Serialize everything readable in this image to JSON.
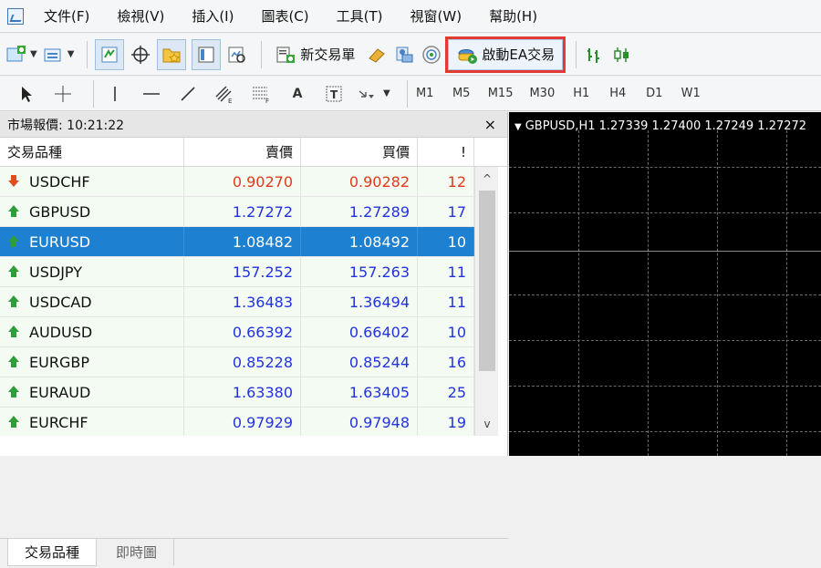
{
  "menu": [
    "文件(F)",
    "檢視(V)",
    "插入(I)",
    "圖表(C)",
    "工具(T)",
    "視窗(W)",
    "幫助(H)"
  ],
  "toolbar1": {
    "new_order": "新交易單",
    "start_ea": "啟動EA交易"
  },
  "toolbar2": {
    "timeframes": [
      "M1",
      "M5",
      "M15",
      "M30",
      "H1",
      "H4",
      "D1",
      "W1"
    ]
  },
  "market_watch": {
    "title": "市場報價: 10:21:22",
    "columns": [
      "交易品種",
      "賣價",
      "買價",
      "!"
    ],
    "rows": [
      {
        "symbol": "USDCHF",
        "bid": "0.90270",
        "ask": "0.90282",
        "spread": "12",
        "dir": "down"
      },
      {
        "symbol": "GBPUSD",
        "bid": "1.27272",
        "ask": "1.27289",
        "spread": "17",
        "dir": "up"
      },
      {
        "symbol": "EURUSD",
        "bid": "1.08482",
        "ask": "1.08492",
        "spread": "10",
        "dir": "up",
        "selected": true
      },
      {
        "symbol": "USDJPY",
        "bid": "157.252",
        "ask": "157.263",
        "spread": "11",
        "dir": "up"
      },
      {
        "symbol": "USDCAD",
        "bid": "1.36483",
        "ask": "1.36494",
        "spread": "11",
        "dir": "up"
      },
      {
        "symbol": "AUDUSD",
        "bid": "0.66392",
        "ask": "0.66402",
        "spread": "10",
        "dir": "up"
      },
      {
        "symbol": "EURGBP",
        "bid": "0.85228",
        "ask": "0.85244",
        "spread": "16",
        "dir": "up"
      },
      {
        "symbol": "EURAUD",
        "bid": "1.63380",
        "ask": "1.63405",
        "spread": "25",
        "dir": "up"
      },
      {
        "symbol": "EURCHF",
        "bid": "0.97929",
        "ask": "0.97948",
        "spread": "19",
        "dir": "up"
      }
    ],
    "tabs": [
      "交易品種",
      "即時圖"
    ]
  },
  "chart": {
    "title": "GBPUSD,H1  1.27339 1.27400 1.27249 1.27272"
  },
  "colors": {
    "down": "#e03a1a",
    "up": "#2233dd",
    "selected_bg": "#1e80d0"
  }
}
